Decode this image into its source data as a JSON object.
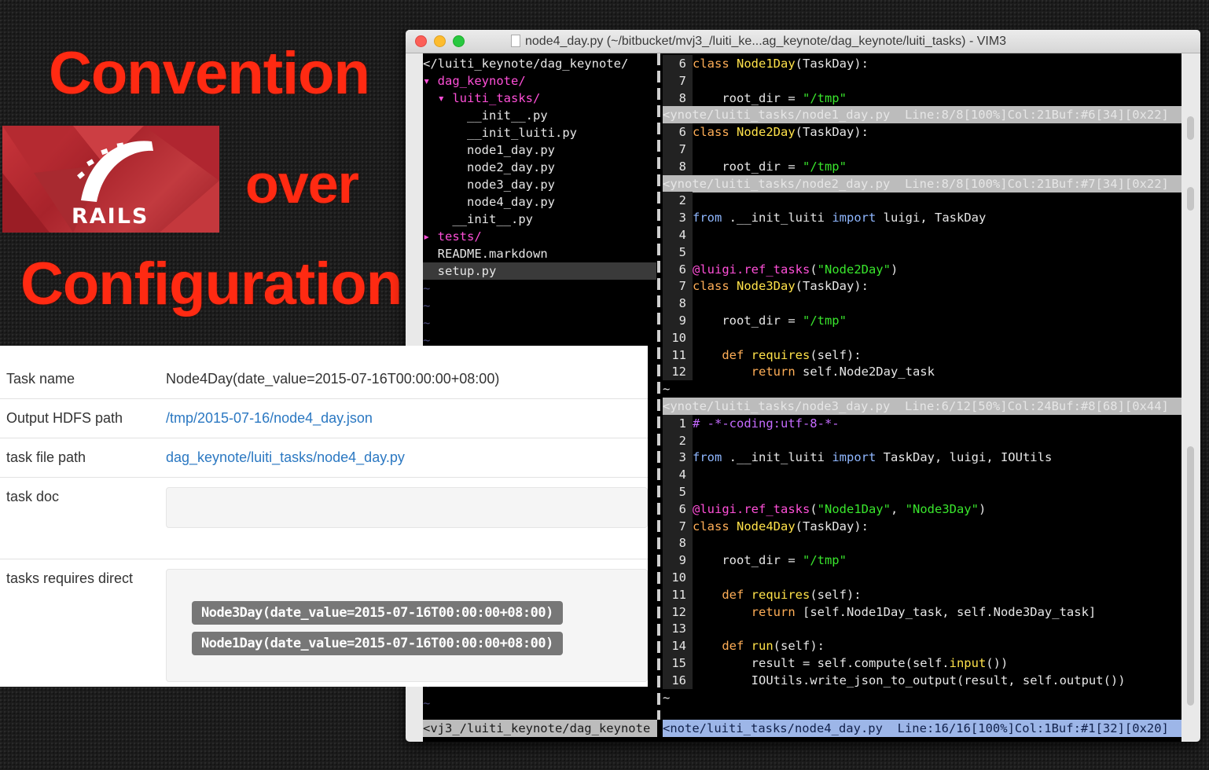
{
  "slide": {
    "word1": "Convention",
    "word2": "over",
    "word3": "Configuration",
    "logo_text": "RAILS"
  },
  "vim": {
    "title": "node4_day.py (~/bitbucket/mvj3_/luiti_ke...ag_keynote/dag_keynote/luiti_tasks) - VIM3",
    "tree": {
      "root": "</luiti_keynote/dag_keynote/",
      "items": [
        {
          "text": "dag_keynote/",
          "arrow": "▾ ",
          "indent": "",
          "type": "dir"
        },
        {
          "text": "luiti_tasks/",
          "arrow": "▾ ",
          "indent": "  ",
          "type": "dir"
        },
        {
          "text": "__init__.py",
          "arrow": "",
          "indent": "      ",
          "type": "file"
        },
        {
          "text": "__init_luiti.py",
          "arrow": "",
          "indent": "      ",
          "type": "file"
        },
        {
          "text": "node1_day.py",
          "arrow": "",
          "indent": "      ",
          "type": "file"
        },
        {
          "text": "node2_day.py",
          "arrow": "",
          "indent": "      ",
          "type": "file"
        },
        {
          "text": "node3_day.py",
          "arrow": "",
          "indent": "      ",
          "type": "file"
        },
        {
          "text": "node4_day.py",
          "arrow": "",
          "indent": "      ",
          "type": "file"
        },
        {
          "text": "__init__.py",
          "arrow": "",
          "indent": "    ",
          "type": "file"
        },
        {
          "text": "tests/",
          "arrow": "▸ ",
          "indent": "",
          "type": "dir"
        },
        {
          "text": "README.markdown",
          "arrow": "",
          "indent": "  ",
          "type": "file"
        },
        {
          "text": "setup.py",
          "arrow": "",
          "indent": "  ",
          "type": "file"
        }
      ],
      "status": "<vj3_/luiti_keynote/dag_keynote"
    },
    "panes": [
      {
        "lines": [
          {
            "n": "6",
            "parts": [
              [
                "kw",
                "class "
              ],
              [
                "fn",
                "Node1Day"
              ],
              [
                "",
                "(TaskDay):"
              ]
            ]
          },
          {
            "n": "7",
            "parts": []
          },
          {
            "n": "8",
            "parts": [
              [
                "",
                "    root_dir = "
              ],
              [
                "str",
                "\"/tmp\""
              ]
            ]
          }
        ],
        "status": "<ynote/luiti_tasks/node1_day.py  Line:8/8[100%]Col:21Buf:#6[34][0x22]"
      },
      {
        "lines": [
          {
            "n": "6",
            "parts": [
              [
                "kw",
                "class "
              ],
              [
                "fn",
                "Node2Day"
              ],
              [
                "",
                "(TaskDay):"
              ]
            ]
          },
          {
            "n": "7",
            "parts": []
          },
          {
            "n": "8",
            "parts": [
              [
                "",
                "    root_dir = "
              ],
              [
                "str",
                "\"/tmp\""
              ]
            ]
          }
        ],
        "status": "<ynote/luiti_tasks/node2_day.py  Line:8/8[100%]Col:21Buf:#7[34][0x22]"
      },
      {
        "lines": [
          {
            "n": "2",
            "parts": []
          },
          {
            "n": "3",
            "parts": [
              [
                "kwb",
                "from "
              ],
              [
                "",
                "."
              ],
              [
                "",
                "__init_luiti "
              ],
              [
                "kwb",
                "import "
              ],
              [
                "",
                "luigi, TaskDay"
              ]
            ]
          },
          {
            "n": "4",
            "parts": []
          },
          {
            "n": "5",
            "parts": []
          },
          {
            "n": "6",
            "parts": [
              [
                "dec",
                "@luigi.ref_tasks"
              ],
              [
                "",
                "("
              ],
              [
                "str",
                "\"Node2Day\""
              ],
              [
                "",
                ")"
              ]
            ]
          },
          {
            "n": "7",
            "parts": [
              [
                "kw",
                "class "
              ],
              [
                "fn",
                "Node3Day"
              ],
              [
                "",
                "(TaskDay):"
              ]
            ]
          },
          {
            "n": "8",
            "parts": []
          },
          {
            "n": "9",
            "parts": [
              [
                "",
                "    root_dir = "
              ],
              [
                "str",
                "\"/tmp\""
              ]
            ]
          },
          {
            "n": "10",
            "parts": []
          },
          {
            "n": "11",
            "parts": [
              [
                "kw",
                "    def "
              ],
              [
                "fn",
                "requires"
              ],
              [
                "",
                "(self):"
              ]
            ]
          },
          {
            "n": "12",
            "parts": [
              [
                "kw",
                "        return "
              ],
              [
                "",
                "self.Node2Day_task"
              ]
            ]
          }
        ],
        "tildes": 1,
        "status": "<ynote/luiti_tasks/node3_day.py  Line:6/12[50%]Col:24Buf:#8[68][0x44]"
      },
      {
        "lines": [
          {
            "n": "1",
            "parts": [
              [
                "cmt",
                "# -*-coding:utf-8-*-"
              ]
            ]
          },
          {
            "n": "2",
            "parts": []
          },
          {
            "n": "3",
            "parts": [
              [
                "kwb",
                "from "
              ],
              [
                "",
                "."
              ],
              [
                "",
                "__init_luiti "
              ],
              [
                "kwb",
                "import "
              ],
              [
                "",
                "TaskDay, luigi, IOUtils"
              ]
            ]
          },
          {
            "n": "4",
            "parts": []
          },
          {
            "n": "5",
            "parts": []
          },
          {
            "n": "6",
            "parts": [
              [
                "dec",
                "@luigi.ref_tasks"
              ],
              [
                "",
                "("
              ],
              [
                "str",
                "\"Node1Day\""
              ],
              [
                "",
                ", "
              ],
              [
                "str",
                "\"Node3Day\""
              ],
              [
                "",
                ")"
              ]
            ]
          },
          {
            "n": "7",
            "parts": [
              [
                "kw",
                "class "
              ],
              [
                "fn",
                "Node4Day"
              ],
              [
                "",
                "(TaskDay):"
              ]
            ]
          },
          {
            "n": "8",
            "parts": []
          },
          {
            "n": "9",
            "parts": [
              [
                "",
                "    root_dir = "
              ],
              [
                "str",
                "\"/tmp\""
              ]
            ]
          },
          {
            "n": "10",
            "parts": []
          },
          {
            "n": "11",
            "parts": [
              [
                "kw",
                "    def "
              ],
              [
                "fn",
                "requires"
              ],
              [
                "",
                "(self):"
              ]
            ]
          },
          {
            "n": "12",
            "parts": [
              [
                "kw",
                "        return "
              ],
              [
                "",
                "[self.Node1Day_task, self.Node3Day_task]"
              ]
            ]
          },
          {
            "n": "13",
            "parts": []
          },
          {
            "n": "14",
            "parts": [
              [
                "kw",
                "    def "
              ],
              [
                "fn",
                "run"
              ],
              [
                "",
                "(self):"
              ]
            ]
          },
          {
            "n": "15",
            "parts": [
              [
                "",
                "        result = self.compute(self."
              ],
              [
                "fn",
                "input"
              ],
              [
                "",
                "())"
              ]
            ]
          },
          {
            "n": "16",
            "parts": [
              [
                "",
                "        IOUtils.write_json_to_output(result, self.output())"
              ]
            ]
          }
        ],
        "tildes": 1,
        "status": "<note/luiti_tasks/node4_day.py  Line:16/16[100%]Col:1Buf:#1[32][0x20]"
      }
    ]
  },
  "info": {
    "task_name_label": "Task name",
    "task_name_value": "Node4Day(date_value=2015-07-16T00:00:00+08:00)",
    "output_label": "Output HDFS path",
    "output_value": "/tmp/2015-07-16/node4_day.json",
    "file_label": "task file path",
    "file_value": "dag_keynote/luiti_tasks/node4_day.py",
    "doc_label": "task doc",
    "requires_label": "tasks requires direct",
    "requires": [
      "Node3Day(date_value=2015-07-16T00:00:00+08:00)",
      "Node1Day(date_value=2015-07-16T00:00:00+08:00)"
    ]
  },
  "colors": {
    "accent_red": "#ff2a12",
    "link_blue": "#2b78c2",
    "vim_keyword": "#ffae57",
    "vim_string": "#39e52c",
    "vim_decorator": "#ff4fd8"
  }
}
